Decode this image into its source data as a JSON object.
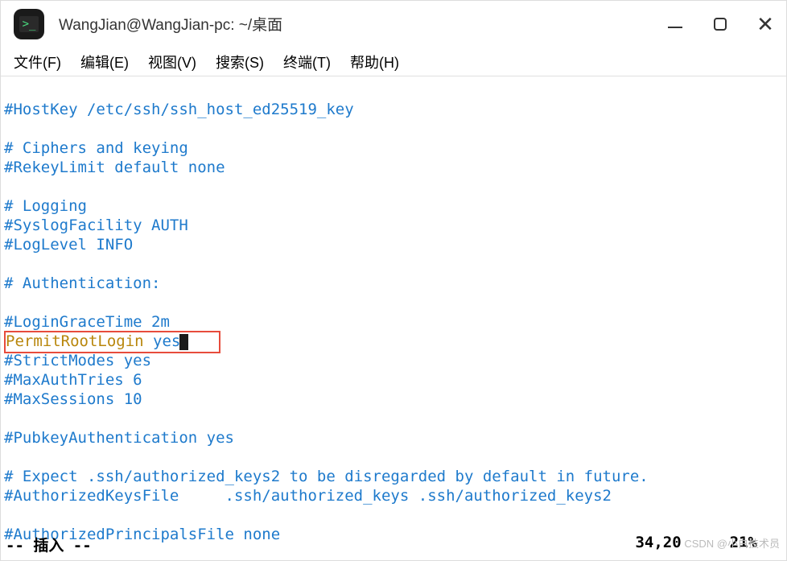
{
  "window": {
    "title": "WangJian@WangJian-pc: ~/桌面",
    "iconText": ">_"
  },
  "menu": {
    "file": "文件(F)",
    "edit": "编辑(E)",
    "view": "视图(V)",
    "search": "搜索(S)",
    "terminal": "终端(T)",
    "help": "帮助(H)"
  },
  "content": {
    "lines": [
      {
        "type": "comment",
        "text": "#HostKey /etc/ssh/ssh_host_ed25519_key"
      },
      {
        "type": "blank",
        "text": ""
      },
      {
        "type": "comment",
        "text": "# Ciphers and keying"
      },
      {
        "type": "comment",
        "text": "#RekeyLimit default none"
      },
      {
        "type": "blank",
        "text": ""
      },
      {
        "type": "comment",
        "text": "# Logging"
      },
      {
        "type": "comment",
        "text": "#SyslogFacility AUTH"
      },
      {
        "type": "comment",
        "text": "#LogLevel INFO"
      },
      {
        "type": "blank",
        "text": ""
      },
      {
        "type": "comment",
        "text": "# Authentication:"
      },
      {
        "type": "blank",
        "text": ""
      },
      {
        "type": "comment",
        "text": "#LoginGraceTime 2m"
      },
      {
        "type": "highlight",
        "key": "PermitRootLogin",
        "value": "yes"
      },
      {
        "type": "comment",
        "text": "#StrictModes yes"
      },
      {
        "type": "comment",
        "text": "#MaxAuthTries 6"
      },
      {
        "type": "comment",
        "text": "#MaxSessions 10"
      },
      {
        "type": "blank",
        "text": ""
      },
      {
        "type": "comment",
        "text": "#PubkeyAuthentication yes"
      },
      {
        "type": "blank",
        "text": ""
      },
      {
        "type": "comment",
        "text": "# Expect .ssh/authorized_keys2 to be disregarded by default in future."
      },
      {
        "type": "comment",
        "text": "#AuthorizedKeysFile     .ssh/authorized_keys .ssh/authorized_keys2"
      },
      {
        "type": "blank",
        "text": ""
      },
      {
        "type": "comment",
        "text": "#AuthorizedPrincipalsFile none"
      }
    ]
  },
  "status": {
    "mode": "-- 插入 --",
    "position": "34,20",
    "scroll": "21%"
  },
  "watermark": "CSDN @小白技术员"
}
